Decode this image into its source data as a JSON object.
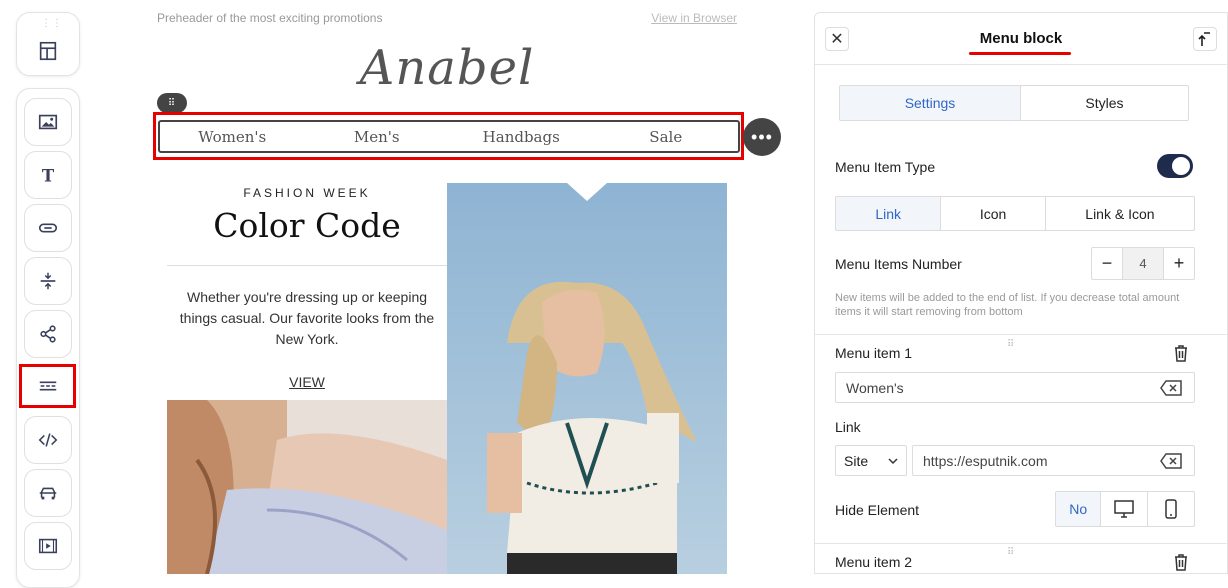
{
  "canvas": {
    "preheader": "Preheader of the most exciting promotions",
    "view_in_browser": "View in Browser",
    "logo": "Anabel",
    "menu_items": [
      "Women's",
      "Men's",
      "Handbags",
      "Sale"
    ],
    "block_handle_icon": "drag-dots-icon",
    "more_icon": "more-dots-icon",
    "eyebrow": "FASHION WEEK",
    "headline": "Color Code",
    "body": "Whether you're dressing up or keeping things casual. Our favorite looks from the New York.",
    "view_link": "VIEW"
  },
  "toolbar": {
    "tools": [
      "layout-icon",
      "image-icon",
      "text-icon",
      "button-icon",
      "spacer-icon",
      "share-icon",
      "menu-icon",
      "html-code-icon",
      "carousel-icon",
      "video-icon"
    ],
    "active_tool": "menu-icon"
  },
  "panel": {
    "title": "Menu block",
    "tabs": [
      "Settings",
      "Styles"
    ],
    "active_tab": "Settings",
    "menu_item_type_label": "Menu Item Type",
    "menu_item_type_toggle": true,
    "type_options": [
      "Link",
      "Icon",
      "Link & Icon"
    ],
    "active_type": "Link",
    "items_number_label": "Menu Items Number",
    "items_number": "4",
    "minus": "−",
    "plus": "+",
    "hint": "New items will be added to the end of list. If you decrease total amount items it will start removing from bottom",
    "item1_label": "Menu item 1",
    "item1_value": "Women's",
    "link_label": "Link",
    "link_type": "Site",
    "link_value": "https://esputnik.com",
    "hide_label": "Hide Element",
    "hide_options": [
      "No",
      "desktop-icon",
      "mobile-icon"
    ],
    "hide_no": "No",
    "item2_label": "Menu item 2"
  },
  "accent_colors": {
    "highlight": "#e60000",
    "active_blue": "#2f68c8",
    "toggle": "#1e2b4d"
  }
}
